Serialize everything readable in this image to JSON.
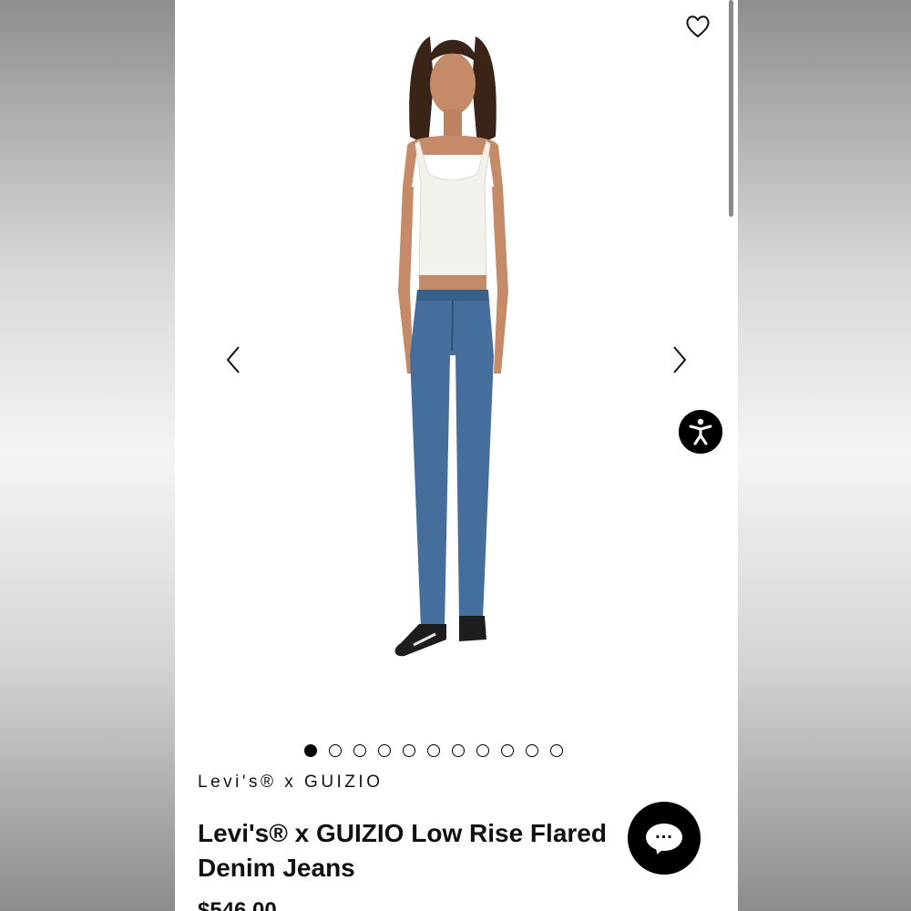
{
  "product": {
    "brand": "Levi's® x GUIZIO",
    "title": "Levi's® x GUIZIO Low Rise Flared Denim Jeans",
    "price": "$546.00"
  },
  "gallery": {
    "image_count": 11,
    "active_index": 0
  },
  "icons": {
    "wishlist": "heart-icon",
    "prev": "chevron-left-icon",
    "next": "chevron-right-icon",
    "accessibility": "accessibility-icon",
    "chat": "chat-bubble-icon"
  },
  "colors": {
    "background": "#ffffff",
    "text": "#111111",
    "button": "#000000"
  }
}
